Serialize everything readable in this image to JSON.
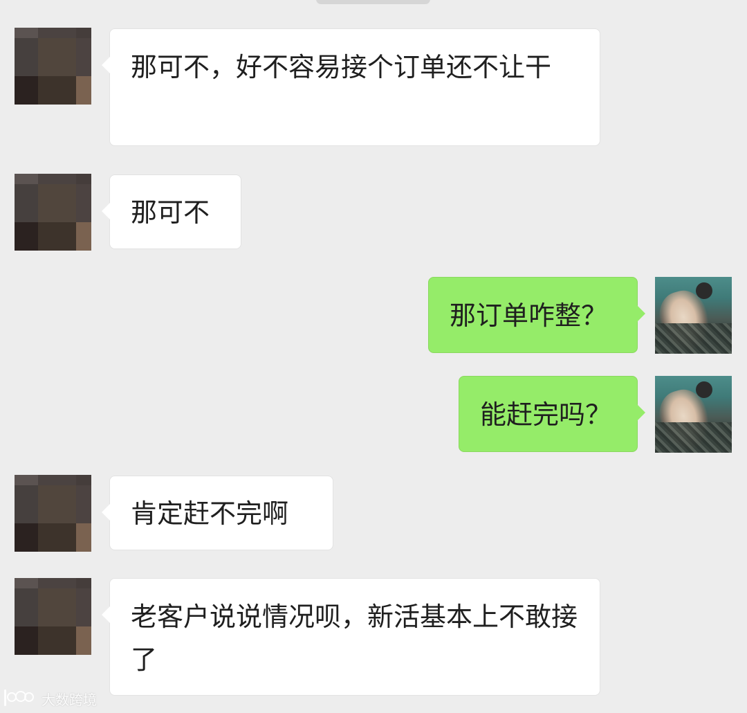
{
  "conversation": {
    "messages": [
      {
        "sender": "other",
        "text": "那可不，好不容易接个订单还不让干",
        "avatar": "pixelated-avatar"
      },
      {
        "sender": "other",
        "text": "那可不",
        "avatar": "pixelated-avatar"
      },
      {
        "sender": "self",
        "text": "那订单咋整？",
        "avatar": "underwater-photo-avatar"
      },
      {
        "sender": "self",
        "text": "能赶完吗？",
        "avatar": "underwater-photo-avatar"
      },
      {
        "sender": "other",
        "text": "肯定赶不完啊",
        "avatar": "pixelated-avatar"
      },
      {
        "sender": "other",
        "text": "老客户说说情况呗，新活基本上不敢接了",
        "avatar": "pixelated-avatar"
      }
    ]
  },
  "watermark": {
    "text": "大数跨境",
    "icon": "brand-logo-icon"
  },
  "colors": {
    "background": "#ededed",
    "incoming_bubble": "#ffffff",
    "outgoing_bubble": "#95ec69",
    "text": "#1f1f1f"
  }
}
